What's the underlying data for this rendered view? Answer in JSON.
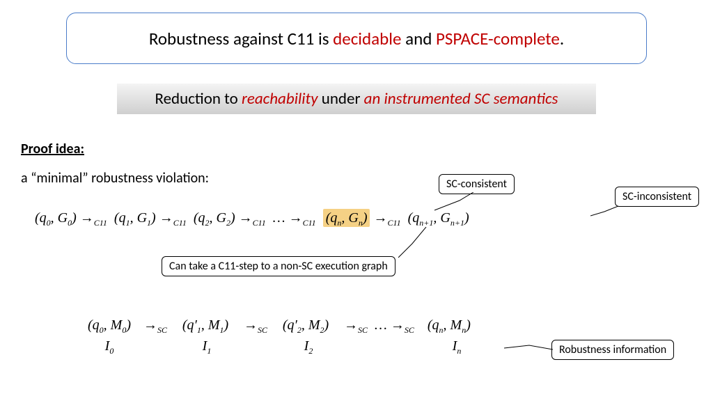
{
  "title": {
    "pre": "Robustness against C11 is ",
    "decidable": "decidable",
    "mid": " and ",
    "pspace": "PSPACE-complete",
    "post": "."
  },
  "subtitle": {
    "pre": "Reduction to ",
    "reach": "reachability",
    "mid": " under ",
    "instr": "an instrumented SC semantics"
  },
  "proof_idea": "Proof idea:",
  "minimal": "a “minimal” robustness violation:",
  "c11sub": "C11",
  "scsub": "SC",
  "labels": {
    "sc_consistent": "SC-consistent",
    "sc_inconsistent": "SC-inconsistent",
    "can_take": "Can take a C11-step to a non-SC execution graph",
    "robustness_info": "Robustness information"
  },
  "chain1": {
    "s0": "(q",
    "s0a": "0",
    "s0b": ", G",
    "s0c": "0",
    "s0d": ")",
    "s1": "(q",
    "s1a": "1",
    "s1b": ", G",
    "s1c": "1",
    "s1d": ")",
    "s2": "(q",
    "s2a": "2",
    "s2b": ", G",
    "s2c": "2",
    "s2d": ")",
    "dots": "…",
    "sn": "(q",
    "sna": "n",
    "snb": ", G",
    "snc": "n",
    "snd": ")",
    "snp": "(q",
    "snpa": "n+1",
    "snpb": ", G",
    "snpc": "n+1",
    "snpd": ")"
  },
  "chain2": {
    "s0": "(q",
    "s0a": "0",
    "s0b": ", M",
    "s0c": "0",
    "s0d": ")",
    "s1": "(q′",
    "s1a": "1",
    "s1b": ", M",
    "s1c": "1",
    "s1d": ")",
    "s2": "(q′",
    "s2a": "2",
    "s2b": ", M",
    "s2c": "2",
    "s2d": ")",
    "dots": "…",
    "sn": "(q",
    "sna": "n",
    "snb": ", M",
    "snc": "n",
    "snd": ")"
  },
  "irow": {
    "i": "I",
    "i0": "0",
    "i1": "1",
    "i2": "2",
    "in": "n"
  }
}
